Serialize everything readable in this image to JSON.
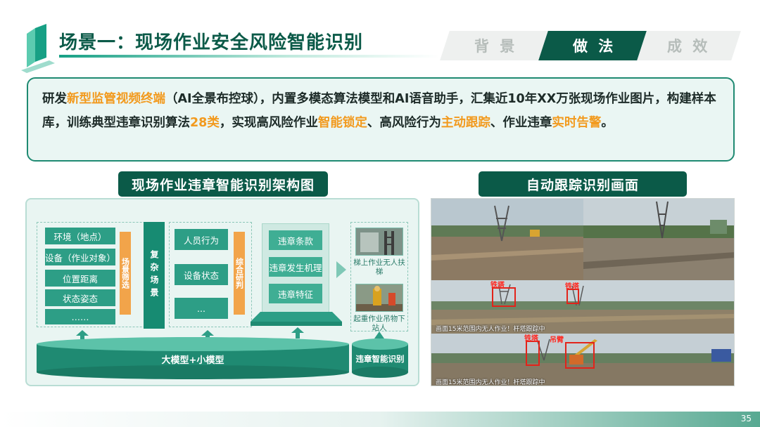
{
  "header": {
    "title": "场景一：现场作业安全风险智能识别",
    "tabs": [
      {
        "label": "背 景",
        "active": false
      },
      {
        "label": "做 法",
        "active": true
      },
      {
        "label": "成 效",
        "active": false
      }
    ]
  },
  "intro": {
    "t1": "研发",
    "h1": "新型监管视频终端",
    "t2": "（AI全景布控球），内置多模态算法模型和AI语音助手，汇集近10年XX万张现场作业图片，构建样本库，训练典型违章识别算法",
    "h2": "28类",
    "t3": "，实现高风险作业",
    "h3": "智能锁定",
    "t4": "、高风险行为",
    "h4": "主动跟踪",
    "t5": "、作业违章",
    "h5": "实时告警",
    "t6": "。"
  },
  "architecture": {
    "label": "现场作业违章智能识别架构图",
    "input_items": [
      "环境（地点）",
      "设备（作业对象）",
      "位置距离",
      "状态姿态",
      "……"
    ],
    "screen_bar": "场景筛选",
    "complex_bar": "复杂场景",
    "behavior_items": [
      "人员行为",
      "设备状态",
      "..."
    ],
    "judge_bar": "综合研判",
    "violation_items": [
      "违章条款",
      "违章发生机理",
      "违章特征"
    ],
    "examples": [
      {
        "caption": "梯上作业无人扶梯"
      },
      {
        "caption": "起重作业吊物下站人"
      }
    ],
    "model_base": "大模型+小模型",
    "result": "违章智能识别"
  },
  "tracking": {
    "label": "自动跟踪识别画面",
    "detections": [
      "铁塔",
      "铁塔",
      "铁塔",
      "吊臂"
    ],
    "overlay_1": "画面15米范围内无人作业！杆塔跟踪中",
    "overlay_2": "画面15米范围内无人作业！杆塔跟踪中"
  },
  "footer": {
    "page": "35"
  },
  "colors": {
    "brand": "#0b5a48",
    "accent": "#f29a1e",
    "panel": "#e9f5f2",
    "box": "#2d9e86"
  }
}
